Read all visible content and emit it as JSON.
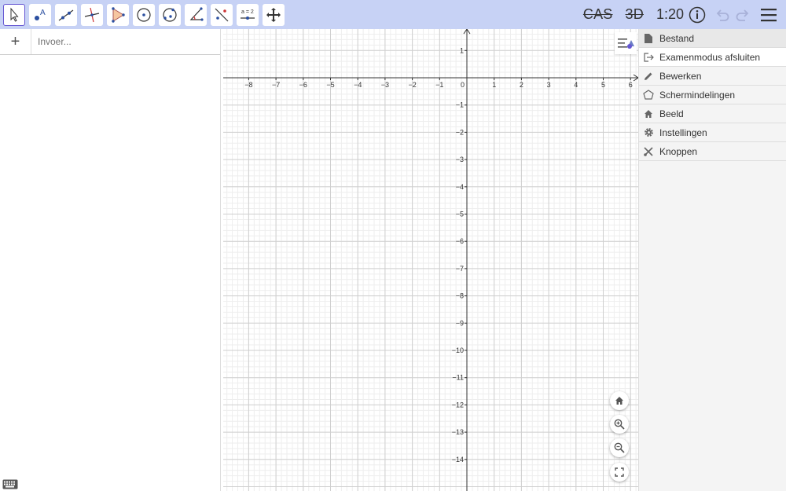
{
  "toolbar": {
    "tools": [
      {
        "name": "move-tool-icon"
      },
      {
        "name": "point-tool-icon"
      },
      {
        "name": "line-tool-icon"
      },
      {
        "name": "perpendicular-line-tool-icon"
      },
      {
        "name": "polygon-tool-icon"
      },
      {
        "name": "circle-tool-icon"
      },
      {
        "name": "circle-three-points-tool-icon"
      },
      {
        "name": "angle-tool-icon"
      },
      {
        "name": "reflect-tool-icon"
      },
      {
        "name": "slider-tool-icon",
        "label": "a = 2"
      },
      {
        "name": "move-graphics-view-tool-icon"
      }
    ],
    "cas_label": "CAS",
    "threed_label": "3D",
    "exam_timer": "1:20",
    "accent": "#6557d2",
    "bar_color": "#c7d2f5"
  },
  "algebra": {
    "add_symbol": "+",
    "input_placeholder": "Invoer..."
  },
  "graphics": {
    "x_ticks": [
      "−8",
      "−7",
      "−6",
      "−5",
      "−4",
      "−3",
      "−2",
      "−1",
      "0",
      "1",
      "2",
      "3",
      "4",
      "5",
      "6"
    ],
    "y_ticks": [
      "1",
      "−1",
      "−2",
      "−3",
      "−4",
      "−5",
      "−6",
      "−7",
      "−8",
      "−9",
      "−10",
      "−11",
      "−12",
      "−13",
      "−14"
    ],
    "controls": [
      "home-icon",
      "zoom-in-icon",
      "zoom-out-icon",
      "fullscreen-icon"
    ]
  },
  "menu": {
    "items": [
      {
        "label": "Bestand",
        "icon": "file-icon"
      },
      {
        "label": "Examenmodus afsluiten",
        "icon": "exit-icon"
      },
      {
        "label": "Bewerken",
        "icon": "pencil-icon"
      },
      {
        "label": "Schermindelingen",
        "icon": "perspectives-icon"
      },
      {
        "label": "Beeld",
        "icon": "home-icon"
      },
      {
        "label": "Instellingen",
        "icon": "gear-icon"
      },
      {
        "label": "Knoppen",
        "icon": "tools-icon"
      }
    ]
  }
}
